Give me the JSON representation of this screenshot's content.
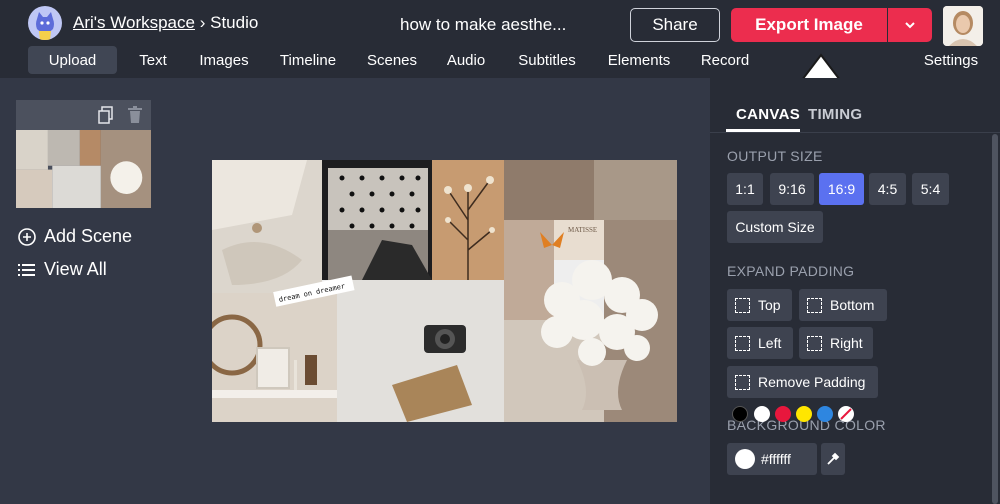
{
  "header": {
    "workspace_link": "Ari's Workspace",
    "separator": "›",
    "section": "Studio",
    "project_title": "how to make aesthe...",
    "share_label": "Share",
    "export_label": "Export Image"
  },
  "nav": {
    "items": [
      "Upload",
      "Text",
      "Images",
      "Timeline",
      "Scenes",
      "Audio",
      "Subtitles",
      "Elements",
      "Record"
    ],
    "settings_label": "Settings"
  },
  "left_panel": {
    "add_scene_label": "Add Scene",
    "view_all_label": "View All"
  },
  "canvas": {
    "sticker_text": "dream on dreamer",
    "matisse_text": "MATISSE"
  },
  "right_panel": {
    "tabs": [
      "CANVAS",
      "TIMING"
    ],
    "output_size_label": "OUTPUT SIZE",
    "output_sizes": [
      "1:1",
      "9:16",
      "16:9",
      "4:5",
      "5:4"
    ],
    "selected_size": "16:9",
    "custom_size_label": "Custom Size",
    "expand_padding_label": "EXPAND PADDING",
    "padding_options": [
      "Top",
      "Bottom",
      "Left",
      "Right"
    ],
    "remove_padding_label": "Remove Padding",
    "background_color_label": "BACKGROUND COLOR",
    "background_color_value": "#ffffff",
    "swatches": [
      "#000000",
      "#ffffff",
      "#e8173d",
      "#ffe600",
      "#2e86e0"
    ]
  },
  "colors": {
    "accent": "#ec2d4e",
    "selected": "#5b71f0"
  }
}
